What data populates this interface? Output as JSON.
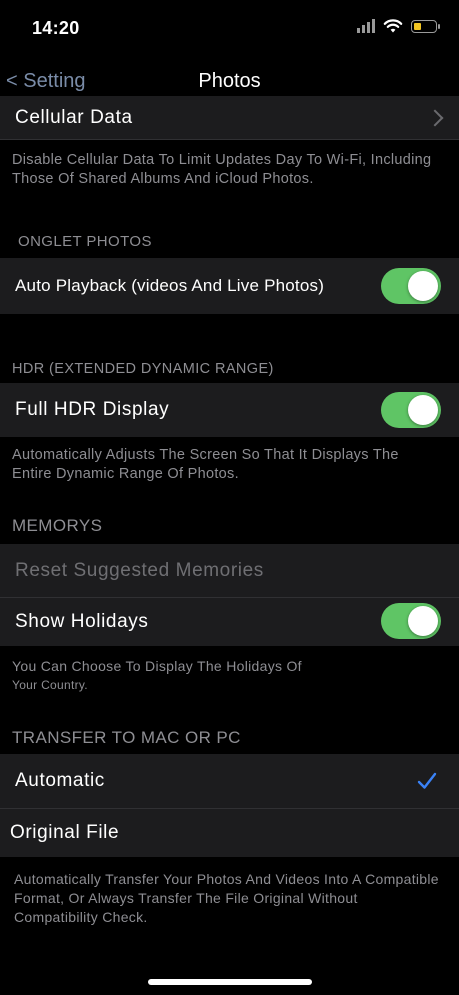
{
  "status_bar": {
    "time": "14:20"
  },
  "nav": {
    "back_label": "< Setting",
    "title": "Photos"
  },
  "rows": {
    "cellular_data": "Cellular Data",
    "auto_playback": "Auto Playback (videos And Live Photos)",
    "full_hdr": "Full HDR Display",
    "reset_memories": "Reset Suggested Memories",
    "show_holidays": "Show Holidays",
    "automatic": "Automatic",
    "original_file": "Original File"
  },
  "footnotes": {
    "cellular": "Disable Cellular Data To Limit Updates Day To Wi-Fi, Including Those Of Shared Albums And iCloud Photos.",
    "hdr": "Automatically Adjusts The Screen So That It Displays The Entire Dynamic Range Of Photos.",
    "holidays_line1": "You Can Choose To Display The Holidays Of",
    "holidays_line2": "Your Country.",
    "transfer": "Automatically Transfer Your Photos And Videos Into A Compatible Format, Or Always Transfer The File Original Without Compatibility Check."
  },
  "sections": {
    "onglet": "ONGLET PHOTOS",
    "hdr": "HDR (EXTENDED DYNAMIC RANGE)",
    "memories": "MEMORYS",
    "transfer": "TRANSFER TO MAC OR PC"
  },
  "toggles": {
    "auto_playback": true,
    "full_hdr": true,
    "show_holidays": true
  },
  "selected_transfer": "Automatic",
  "colors": {
    "toggle_on": "#5fc565",
    "checkmark": "#3a82f7",
    "battery": "#f3c623"
  }
}
